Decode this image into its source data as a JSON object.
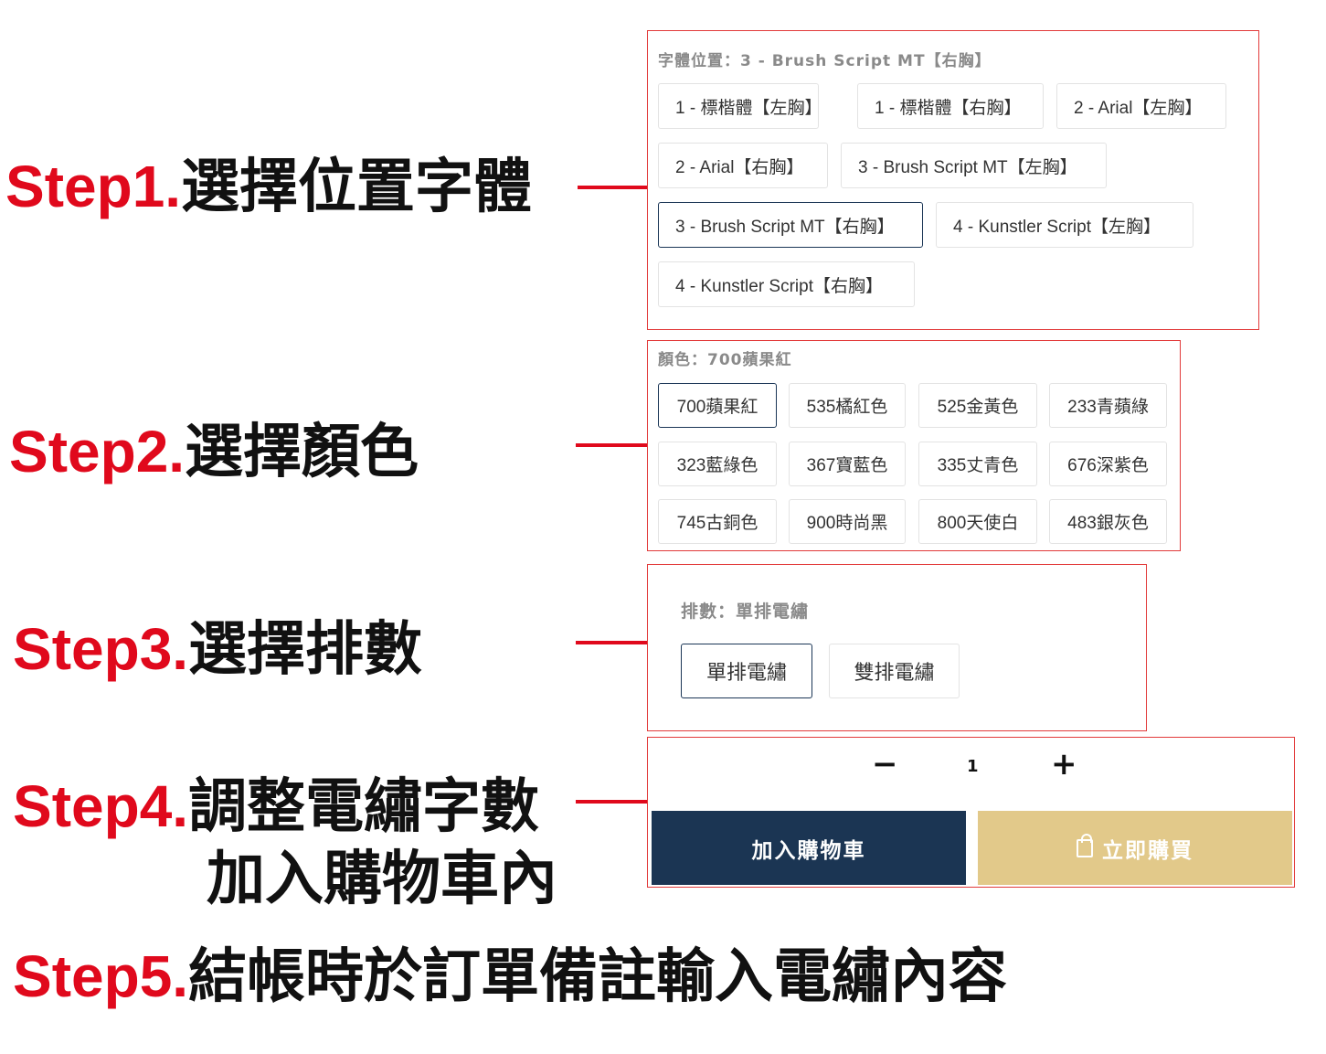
{
  "steps": [
    {
      "num": "Step1.",
      "text": "選擇位置字體"
    },
    {
      "num": "Step2.",
      "text": "選擇顏色"
    },
    {
      "num": "Step3.",
      "text": "選擇排數"
    },
    {
      "num": "Step4.",
      "text": "調整電繡字數",
      "text2": "加入購物車內"
    },
    {
      "num": "Step5.",
      "text": "結帳時於訂單備註輸入電繡內容"
    }
  ],
  "font_position": {
    "label": "字體位置：3 - Brush Script MT【右胸】",
    "options": [
      "1 - 標楷體【左胸】",
      "1 - 標楷體【右胸】",
      "2 - Arial【左胸】",
      "2 - Arial【右胸】",
      "3 - Brush Script MT【左胸】",
      "3 - Brush Script MT【右胸】",
      "4 - Kunstler Script【左胸】",
      "4 - Kunstler Script【右胸】"
    ],
    "selected_index": 5
  },
  "color": {
    "label": "顏色：700蘋果紅",
    "options": [
      "700蘋果紅",
      "535橘紅色",
      "525金黃色",
      "233青蘋綠",
      "323藍綠色",
      "367寶藍色",
      "335丈青色",
      "676深紫色",
      "745古銅色",
      "900時尚黑",
      "800天使白",
      "483銀灰色"
    ],
    "selected_index": 0
  },
  "rows": {
    "label": "排數：單排電繡",
    "options": [
      "單排電繡",
      "雙排電繡"
    ],
    "selected_index": 0
  },
  "quantity": {
    "minus": "−",
    "value": "1",
    "plus": "+"
  },
  "actions": {
    "add_to_cart": "加入購物車",
    "buy_now": "立即購買"
  },
  "colors": {
    "accent_red": "#e0091c",
    "navy": "#1b3553",
    "gold": "#e2c98a"
  },
  "icons": {
    "buy_now": "shopping-bag-icon"
  }
}
